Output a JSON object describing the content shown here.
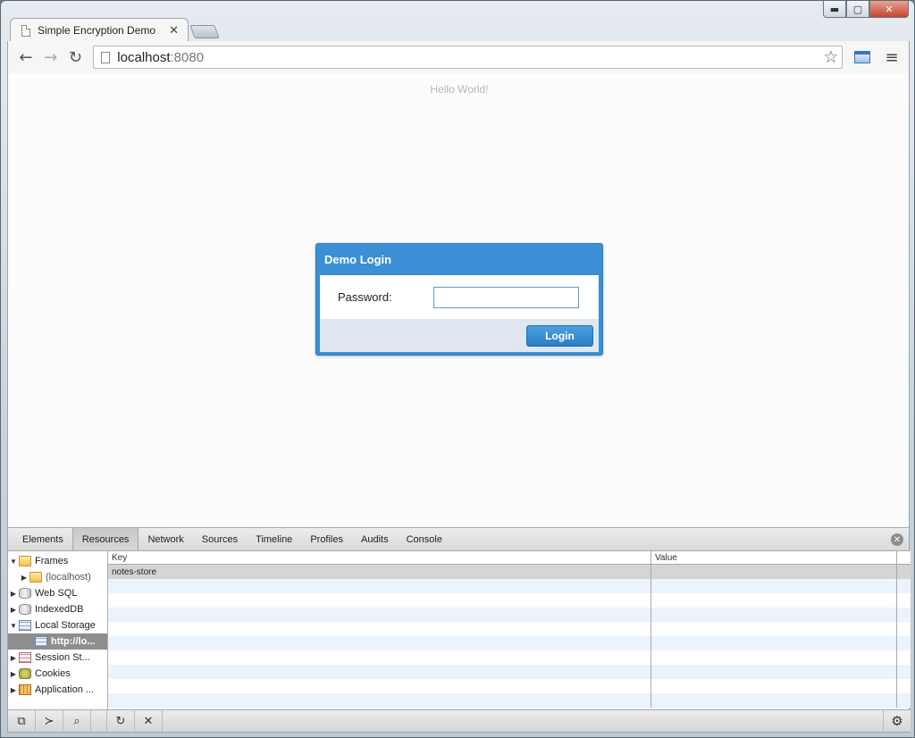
{
  "window": {
    "tab_title": "Simple Encryption Demo",
    "controls": {
      "minimize": "▬",
      "maximize": "▢",
      "close": "✕"
    }
  },
  "toolbar": {
    "url_host": "localhost",
    "url_port": ":8080",
    "icons": {
      "back": "←",
      "forward": "→",
      "reload": "↻",
      "star": "☆",
      "menu": "≡"
    }
  },
  "page": {
    "hello": "Hello World!",
    "login": {
      "title": "Demo Login",
      "password_label": "Password:",
      "password_value": "",
      "login_button": "Login"
    }
  },
  "devtools": {
    "tabs": [
      "Elements",
      "Resources",
      "Network",
      "Sources",
      "Timeline",
      "Profiles",
      "Audits",
      "Console"
    ],
    "active_tab": "Resources",
    "tree": [
      {
        "label": "Frames",
        "expanded": true
      },
      {
        "label": "(localhost)"
      },
      {
        "label": "Web SQL"
      },
      {
        "label": "IndexedDB"
      },
      {
        "label": "Local Storage",
        "expanded": true
      },
      {
        "label": "http://lo...",
        "selected": true
      },
      {
        "label": "Session St..."
      },
      {
        "label": "Cookies"
      },
      {
        "label": "Application ..."
      }
    ],
    "grid": {
      "headers": {
        "key": "Key",
        "value": "Value"
      },
      "rows": [
        {
          "key": "notes-store",
          "value": ""
        }
      ]
    },
    "status_icons": {
      "dock": "⧉",
      "console": "≻",
      "search": "⌕",
      "refresh": "↻",
      "delete": "✕",
      "settings": "⚙"
    },
    "close_icon": "✕"
  },
  "colors": {
    "accent": "#3b8fd4",
    "login_footer": "#dfe8f1",
    "grid_stripe": "#ebf3fc"
  }
}
